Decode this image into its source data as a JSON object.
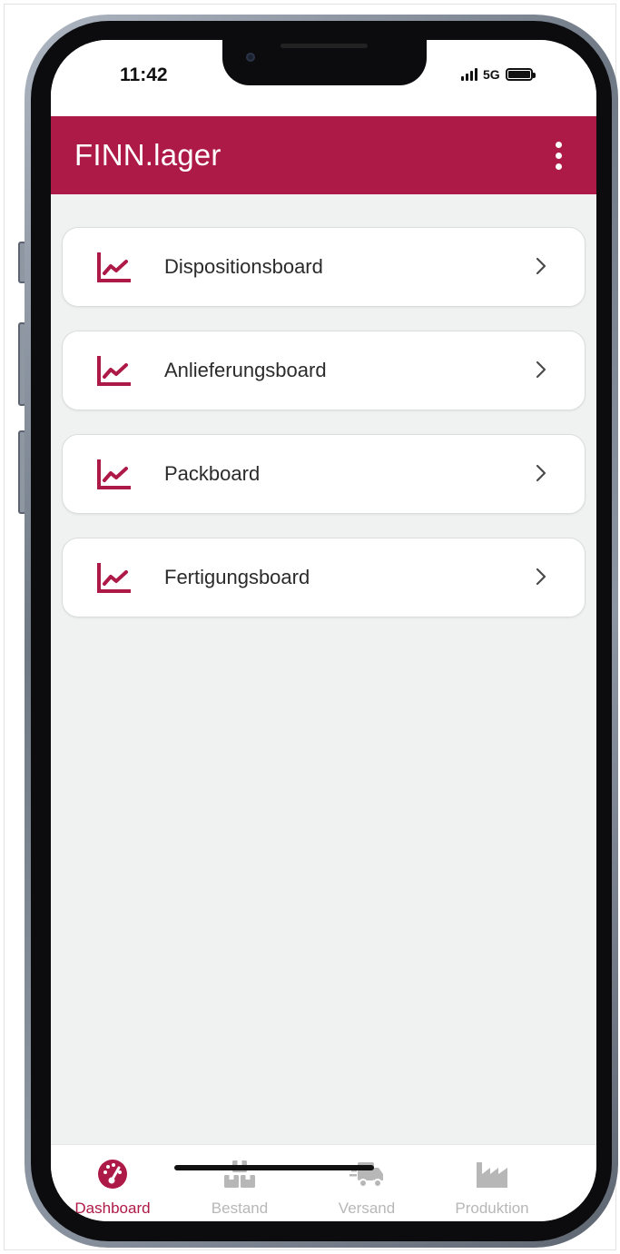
{
  "status_bar": {
    "time": "11:42",
    "network": "5G"
  },
  "app_bar": {
    "title": "FINN.lager",
    "menu_icon": "more-vert-icon"
  },
  "boards": [
    {
      "label": "Dispositionsboard",
      "icon": "line-chart-icon"
    },
    {
      "label": "Anlieferungsboard",
      "icon": "line-chart-icon"
    },
    {
      "label": "Packboard",
      "icon": "line-chart-icon"
    },
    {
      "label": "Fertigungsboard",
      "icon": "line-chart-icon"
    }
  ],
  "bottom_nav": {
    "items": [
      {
        "label": "Dashboard",
        "icon": "dashboard-gauge-icon",
        "active": true
      },
      {
        "label": "Bestand",
        "icon": "boxes-icon",
        "active": false
      },
      {
        "label": "Versand",
        "icon": "truck-icon",
        "active": false
      },
      {
        "label": "Produktion",
        "icon": "factory-icon",
        "active": false
      }
    ]
  },
  "colors": {
    "accent": "#ae1a47",
    "background": "#f0f1f1",
    "inactive": "#b7b7b7"
  }
}
